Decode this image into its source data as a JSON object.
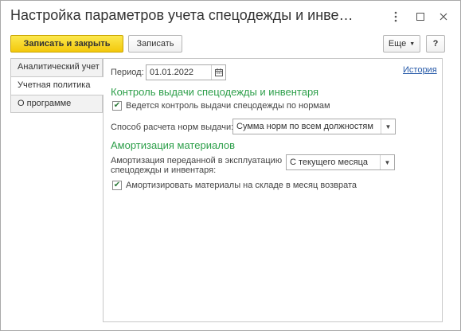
{
  "window": {
    "title": "Настройка параметров учета спецодежды и инве…",
    "more_icon": "vertical-dots-icon",
    "maximize_icon": "maximize-icon",
    "close_icon": "close-icon"
  },
  "toolbar": {
    "save_close_label": "Записать и закрыть",
    "save_label": "Записать",
    "more_label": "Еще",
    "help_label": "?"
  },
  "tabs": [
    {
      "label": "Аналитический учет"
    },
    {
      "label": "Учетная политика",
      "active": true
    },
    {
      "label": "О программе"
    }
  ],
  "form": {
    "period_label": "Период:",
    "period_value": "01.01.2022",
    "history_link": "История",
    "section1_title": "Контроль выдачи спецодежды и инвентаря",
    "check1_label": "Ведется контроль выдачи спецодежды по нормам",
    "check1_checked": true,
    "calc_method_label": "Способ расчета норм выдачи:",
    "calc_method_value": "Сумма норм по всем должностям",
    "section2_title": "Амортизация материалов",
    "amort_label_line1": "Амортизация переданной в эксплуатацию",
    "amort_label_line2": "спецодежды и инвентаря:",
    "amort_value": "С текущего месяца",
    "check2_label": "Амортизировать материалы на складе в месяц возврата",
    "check2_checked": true
  },
  "colors": {
    "accent_green": "#2d9f4a",
    "primary_button": "#f3c80b",
    "link": "#2659a8"
  }
}
